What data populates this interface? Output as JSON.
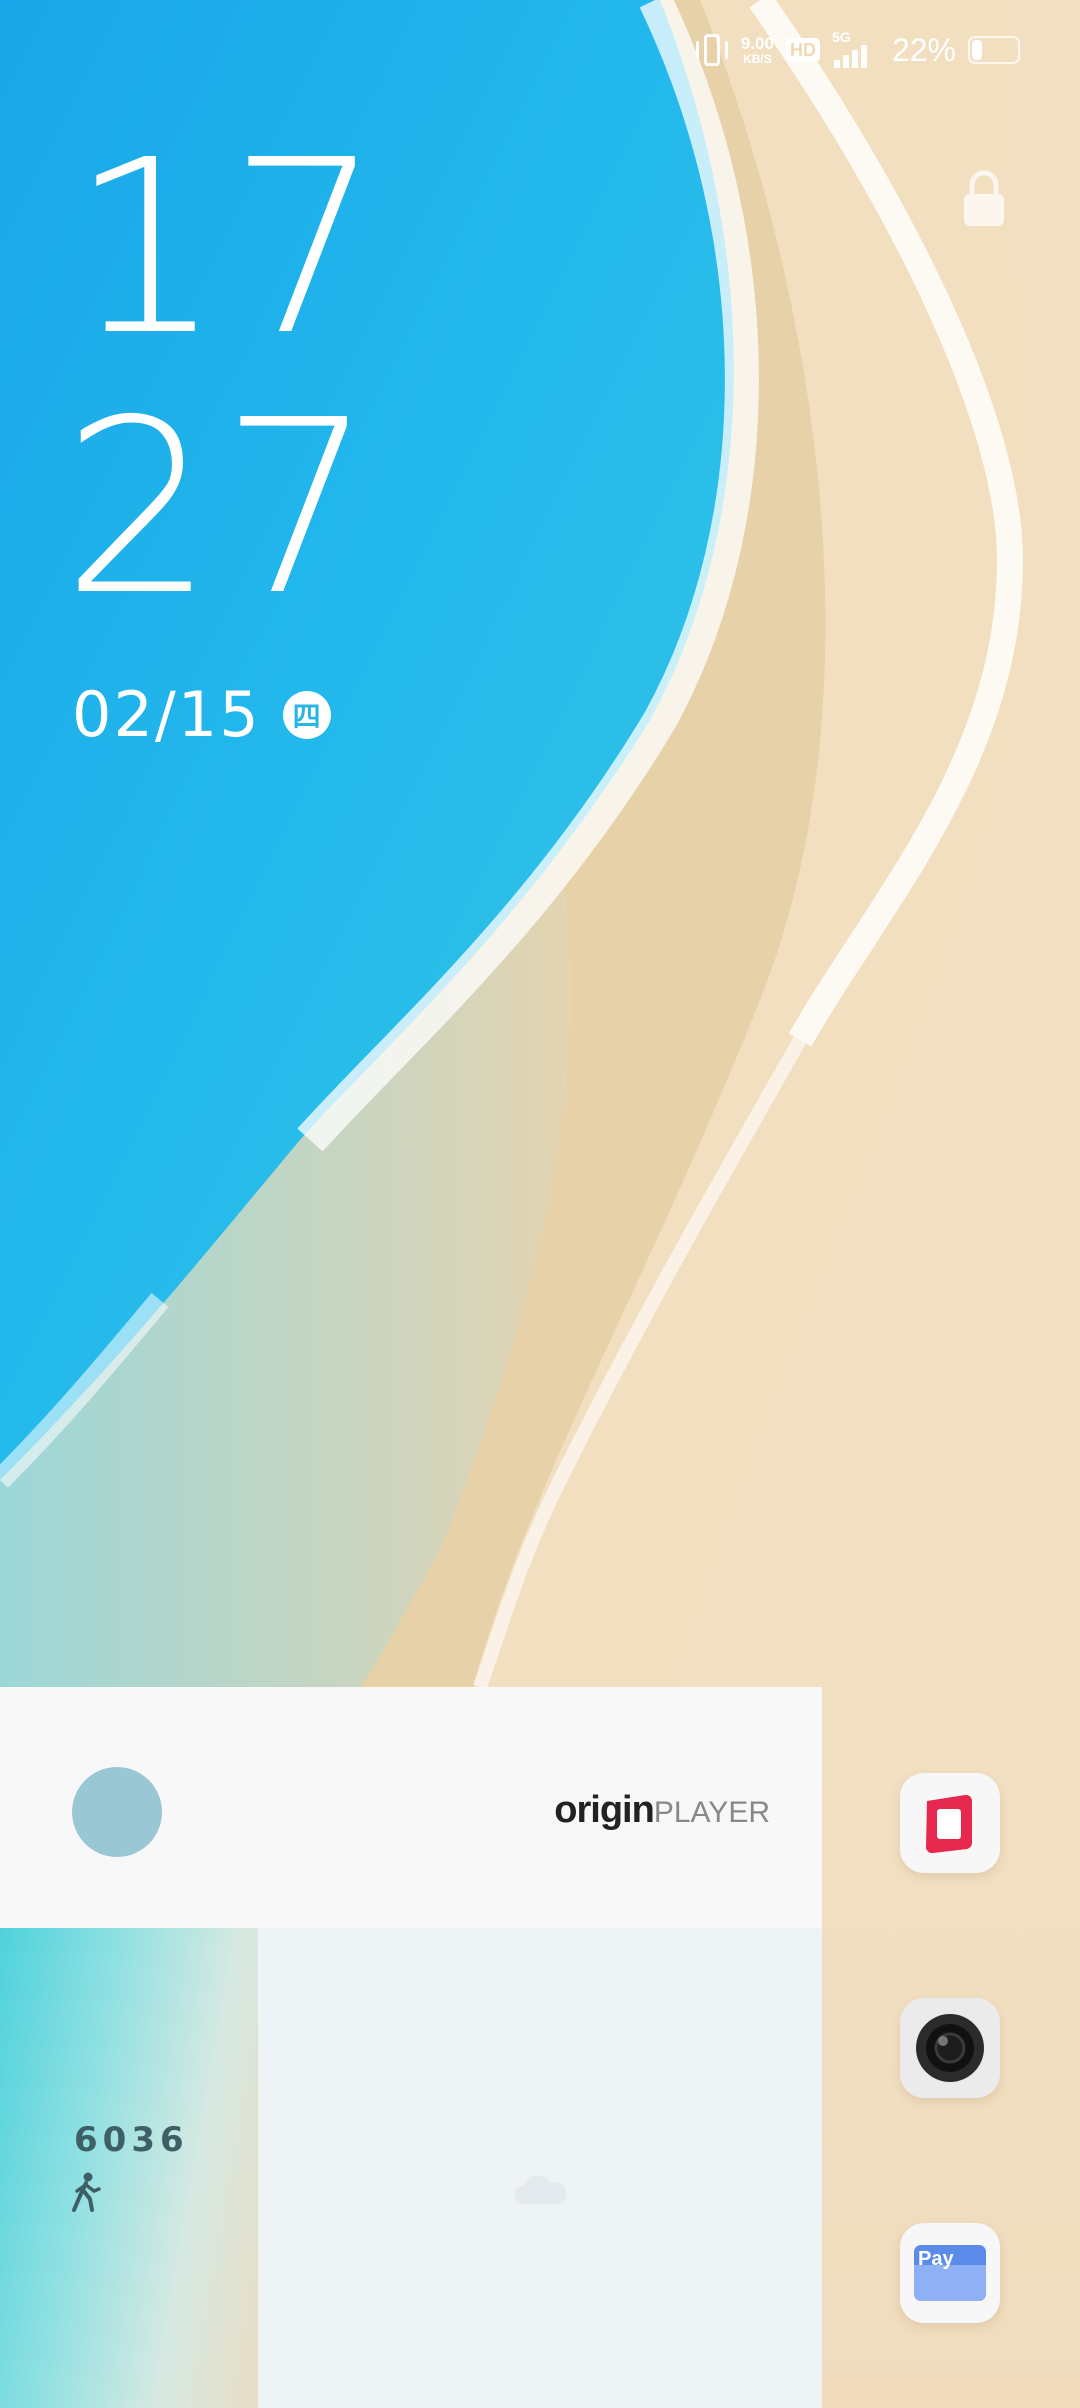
{
  "status_bar": {
    "net_speed": "9.00",
    "net_unit": "KB/S",
    "hd_label": "HD",
    "network_type": "5G",
    "signal_level": 4,
    "battery_percent": "22%",
    "battery_level": 0.22,
    "vibrate_icon": "vibrate-icon",
    "signal_icon": "signal-icon",
    "battery_icon": "battery-icon"
  },
  "lock": {
    "icon": "lock-icon"
  },
  "clock": {
    "hours": "17",
    "minutes": "27",
    "date": "02/15",
    "weekday": "四"
  },
  "music_widget": {
    "brand_origin": "origin",
    "brand_player": "PLAYER"
  },
  "steps_widget": {
    "steps": "6036",
    "icon": "walking-icon"
  },
  "dock": {
    "apps": [
      {
        "icon": "red-square-app-icon"
      },
      {
        "icon": "camera-icon"
      },
      {
        "icon": "wallet-icon",
        "label": "Pay"
      }
    ]
  },
  "colors": {
    "sea": "#29b6e6",
    "sand": "#f2dfc0",
    "card": "#f8f8f8",
    "app_red": "#e6284f"
  }
}
